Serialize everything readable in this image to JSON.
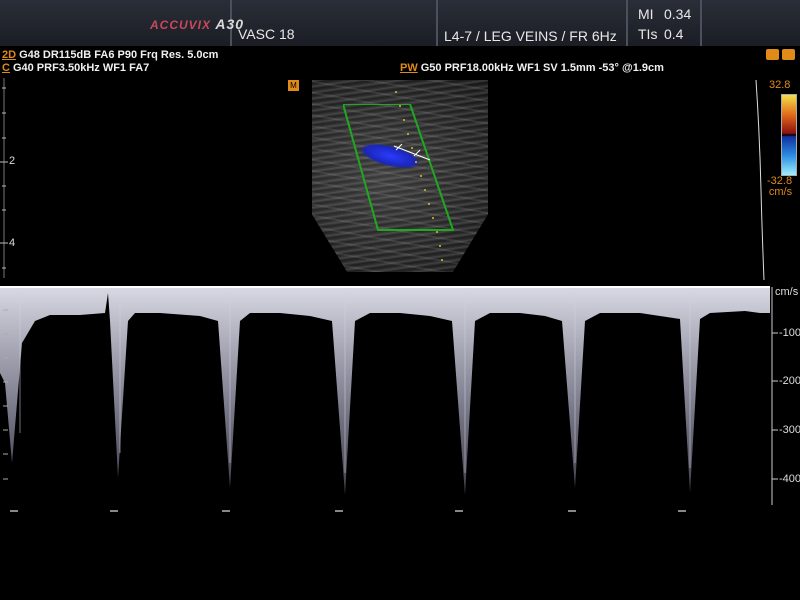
{
  "header": {
    "logo_brand": "ACCUVIX",
    "logo_model": "A30",
    "study": "VASC 18",
    "probe_preset": "L4-7 / LEG VEINS / FR 6Hz",
    "mi_label": "MI",
    "mi_value": "0.34",
    "tis_label": "TIs",
    "tis_value": "0.4"
  },
  "params": {
    "twod_key": "2D",
    "twod_text": "G48 DR115dB FA6 P90 Frq Res. 5.0cm",
    "color_key": "C",
    "color_text": "G40 PRF3.50kHz WF1 FA7",
    "pw_key": "PW",
    "pw_text": "G50 PRF18.00kHz WF1 SV 1.5mm -53° @1.9cm"
  },
  "image_badge": "M",
  "color_scale": {
    "max": "32.8",
    "min": "-32.8",
    "unit": "cm/s"
  },
  "depth_labels": [
    "2",
    "4"
  ],
  "doppler": {
    "unit": "cm/s",
    "velocity_labels": [
      "-100",
      "-200",
      "-300",
      "-400"
    ],
    "colors": {
      "waveform": "#c8c8d8",
      "baseline": "#ffffff"
    }
  }
}
